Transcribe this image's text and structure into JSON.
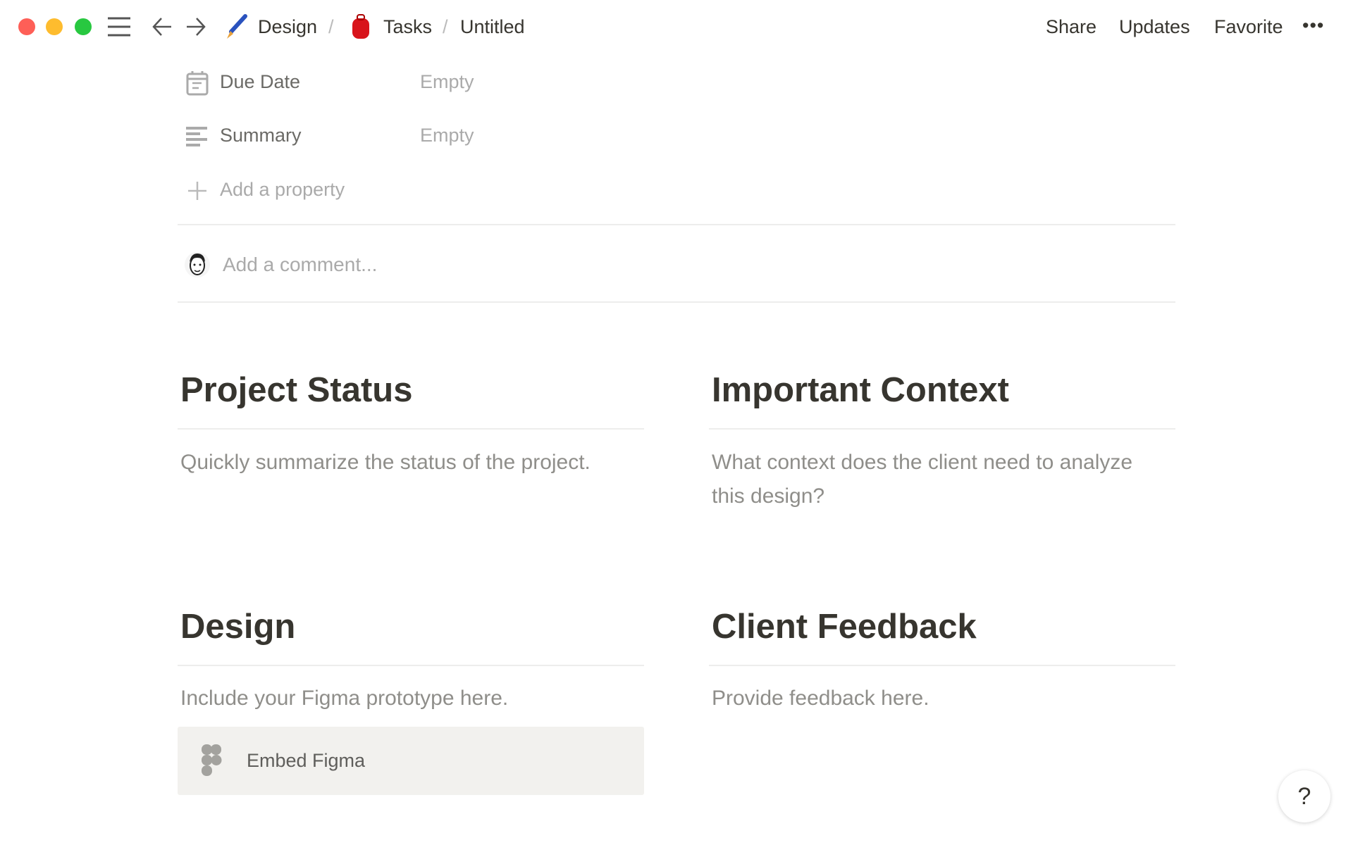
{
  "topbar": {
    "breadcrumbs": [
      {
        "icon": "paintbrush-icon",
        "label": "Design"
      },
      {
        "icon": "backpack-icon",
        "label": "Tasks"
      },
      {
        "label": "Untitled"
      }
    ],
    "separator": "/",
    "actions": {
      "share": "Share",
      "updates": "Updates",
      "favorite": "Favorite",
      "more": "•••"
    }
  },
  "properties": [
    {
      "icon": "calendar-icon",
      "label": "Due Date",
      "value": "Empty"
    },
    {
      "icon": "text-lines-icon",
      "label": "Summary",
      "value": "Empty"
    }
  ],
  "add_property": "Add a property",
  "comment": {
    "placeholder": "Add a comment..."
  },
  "sections": {
    "project_status": {
      "title": "Project Status",
      "text": "Quickly summarize the status of the project."
    },
    "important_context": {
      "title": "Important Context",
      "text": "What context does the client need to analyze this design?"
    },
    "design": {
      "title": "Design",
      "text": "Include your Figma prototype here.",
      "embed": "Embed Figma"
    },
    "client_feedback": {
      "title": "Client Feedback",
      "text": "Provide feedback here."
    }
  },
  "help": "?",
  "colors": {
    "close": "#fe5f57",
    "minimize": "#febc2e",
    "maximize": "#28c840",
    "embed_bg": "#f2f1ee"
  }
}
